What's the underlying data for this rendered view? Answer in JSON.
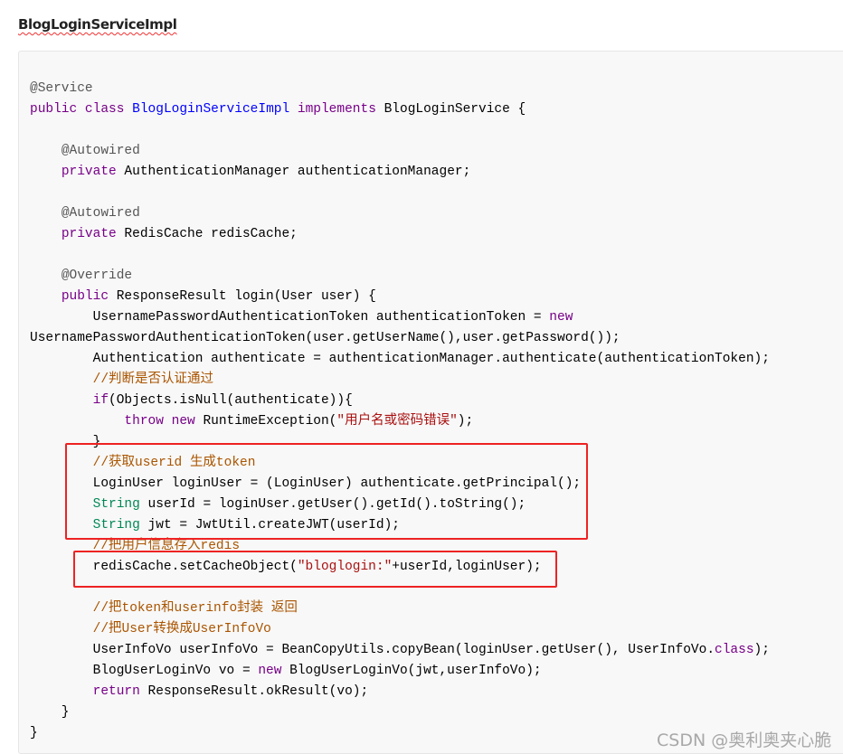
{
  "heading": "BlogLoginServiceImpl",
  "watermark": "CSDN @奥利奥夹心脆",
  "colors": {
    "keyword": "#770088",
    "definition": "#0000ff",
    "annotation": "#555555",
    "comment": "#aa5500",
    "string": "#aa1111",
    "type": "#008855",
    "highlight_box": "#ee2222"
  },
  "code_lines": [
    [
      [
        "m",
        "@Service"
      ]
    ],
    [
      [
        "k",
        "public"
      ],
      [
        "p",
        " "
      ],
      [
        "k",
        "class"
      ],
      [
        "p",
        " "
      ],
      [
        "d",
        "BlogLoginServiceImpl"
      ],
      [
        "p",
        " "
      ],
      [
        "k",
        "implements"
      ],
      [
        "p",
        " BlogLoginService {"
      ]
    ],
    [],
    [
      [
        "p",
        "    "
      ],
      [
        "m",
        "@Autowired"
      ]
    ],
    [
      [
        "p",
        "    "
      ],
      [
        "k",
        "private"
      ],
      [
        "p",
        " AuthenticationManager authenticationManager;"
      ]
    ],
    [],
    [
      [
        "p",
        "    "
      ],
      [
        "m",
        "@Autowired"
      ]
    ],
    [
      [
        "p",
        "    "
      ],
      [
        "k",
        "private"
      ],
      [
        "p",
        " RedisCache redisCache;"
      ]
    ],
    [],
    [
      [
        "p",
        "    "
      ],
      [
        "m",
        "@Override"
      ]
    ],
    [
      [
        "p",
        "    "
      ],
      [
        "k",
        "public"
      ],
      [
        "p",
        " ResponseResult login(User user) {"
      ]
    ],
    [
      [
        "p",
        "        UsernamePasswordAuthenticationToken authenticationToken = "
      ],
      [
        "k",
        "new"
      ]
    ],
    [
      [
        "p",
        "UsernamePasswordAuthenticationToken(user.getUserName(),user.getPassword());"
      ]
    ],
    [
      [
        "p",
        "        Authentication authenticate = authenticationManager.authenticate(authenticationToken);"
      ]
    ],
    [
      [
        "p",
        "        "
      ],
      [
        "c",
        "//判断是否认证通过"
      ]
    ],
    [
      [
        "p",
        "        "
      ],
      [
        "k",
        "if"
      ],
      [
        "p",
        "(Objects.isNull(authenticate)){"
      ]
    ],
    [
      [
        "p",
        "            "
      ],
      [
        "k",
        "throw"
      ],
      [
        "p",
        " "
      ],
      [
        "k",
        "new"
      ],
      [
        "p",
        " RuntimeException("
      ],
      [
        "s",
        "\"用户名或密码错误\""
      ],
      [
        "p",
        ");"
      ]
    ],
    [
      [
        "p",
        "        }"
      ]
    ],
    [
      [
        "p",
        "        "
      ],
      [
        "c",
        "//获取userid 生成token"
      ]
    ],
    [
      [
        "p",
        "        LoginUser loginUser = (LoginUser) authenticate.getPrincipal();"
      ]
    ],
    [
      [
        "p",
        "        "
      ],
      [
        "t",
        "String"
      ],
      [
        "p",
        " userId = loginUser.getUser().getId().toString();"
      ]
    ],
    [
      [
        "p",
        "        "
      ],
      [
        "t",
        "String"
      ],
      [
        "p",
        " jwt = JwtUtil.createJWT(userId);"
      ]
    ],
    [
      [
        "p",
        "        "
      ],
      [
        "c",
        "//把用户信息存入redis"
      ]
    ],
    [
      [
        "p",
        "        redisCache.setCacheObject("
      ],
      [
        "s",
        "\"bloglogin:\""
      ],
      [
        "p",
        "+userId,loginUser);"
      ]
    ],
    [],
    [
      [
        "p",
        "        "
      ],
      [
        "c",
        "//把token和userinfo封装 返回"
      ]
    ],
    [
      [
        "p",
        "        "
      ],
      [
        "c",
        "//把User转换成UserInfoVo"
      ]
    ],
    [
      [
        "p",
        "        UserInfoVo userInfoVo = BeanCopyUtils.copyBean(loginUser.getUser(), UserInfoVo."
      ],
      [
        "k",
        "class"
      ],
      [
        "p",
        ");"
      ]
    ],
    [
      [
        "p",
        "        BlogUserLoginVo vo = "
      ],
      [
        "k",
        "new"
      ],
      [
        "p",
        " BlogUserLoginVo(jwt,userInfoVo);"
      ]
    ],
    [
      [
        "p",
        "        "
      ],
      [
        "k",
        "return"
      ],
      [
        "p",
        " ResponseResult.okResult(vo);"
      ]
    ],
    [
      [
        "p",
        "    }"
      ]
    ],
    [
      [
        "p",
        "}"
      ]
    ]
  ]
}
